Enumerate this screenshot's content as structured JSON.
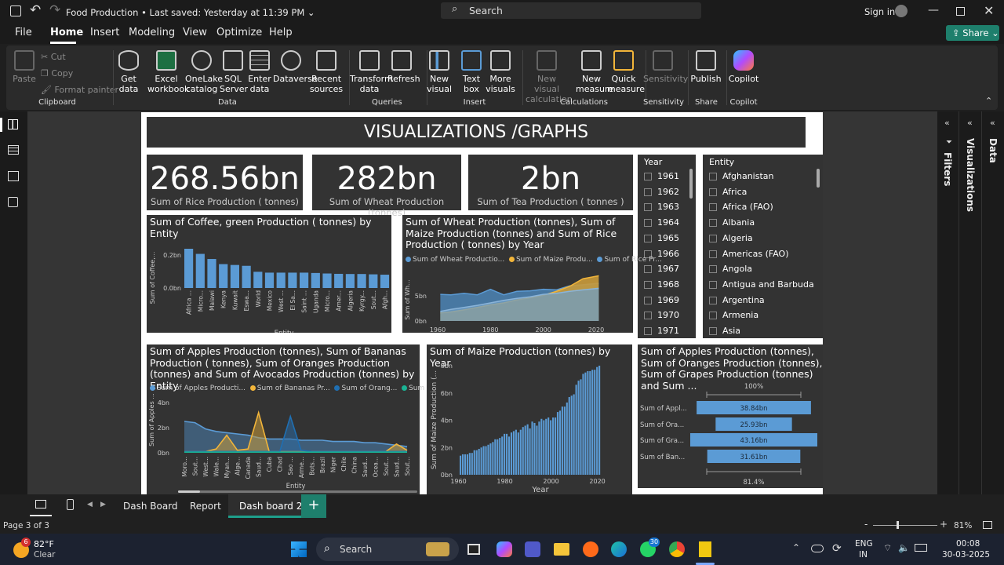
{
  "titlebar": {
    "file_name": "Food Production",
    "separator": " • ",
    "saved": "Last saved: Yesterday at 11:39 PM",
    "search": "Search",
    "signin": "Sign in"
  },
  "menu": [
    "File",
    "Home",
    "Insert",
    "Modeling",
    "View",
    "Optimize",
    "Help"
  ],
  "share": "Share",
  "ribbon": {
    "clipboard": {
      "paste": "Paste",
      "cut": "Cut",
      "copy": "Copy",
      "format_painter": "Format painter",
      "group": "Clipboard"
    },
    "data": {
      "get_data": "Get data",
      "excel": "Excel workbook",
      "onelake": "OneLake catalog",
      "sql": "SQL Server",
      "enter": "Enter data",
      "dataverse": "Dataverse",
      "recent": "Recent sources",
      "group": "Data"
    },
    "queries": {
      "transform": "Transform data",
      "refresh": "Refresh",
      "group": "Queries"
    },
    "insert": {
      "new_visual": "New visual",
      "text_box": "Text box",
      "more_visuals": "More visuals",
      "group": "Insert"
    },
    "calculations": {
      "new_visual_calc": "New visual calculation",
      "new_measure": "New measure",
      "quick_measure": "Quick measure",
      "group": "Calculations"
    },
    "sensitivity": {
      "label": "Sensitivity",
      "group": "Sensitivity"
    },
    "share": {
      "publish": "Publish",
      "group": "Share"
    },
    "copilot": {
      "label": "Copilot",
      "group": "Copilot"
    }
  },
  "report": {
    "header": "VISUALIZATIONS /GRAPHS",
    "kpis": [
      {
        "value": "268.56bn",
        "label": "Sum of Rice  Production ( tonnes)"
      },
      {
        "value": "282bn",
        "label": "Sum of Wheat Production (tonnes)"
      },
      {
        "value": "2bn",
        "label": "Sum of Tea  Production ( tonnes )"
      }
    ],
    "year_slicer": {
      "title": "Year",
      "items": [
        "1961",
        "1962",
        "1963",
        "1964",
        "1965",
        "1966",
        "1967",
        "1968",
        "1969",
        "1970",
        "1971"
      ]
    },
    "entity_slicer": {
      "title": "Entity",
      "items": [
        "Afghanistan",
        "Africa",
        "Africa (FAO)",
        "Albania",
        "Algeria",
        "Americas (FAO)",
        "Angola",
        "Antigua and Barbuda",
        "Argentina",
        "Armenia",
        "Asia"
      ]
    },
    "coffee": {
      "title": "Sum of Coffee, green Production ( tonnes) by Entity",
      "ylabel": "Sum of Coffee,...",
      "xlabel": "Entity",
      "yticks": [
        "0.2bn",
        "0.0bn"
      ]
    },
    "wmr": {
      "title": "Sum of Wheat Production (tonnes), Sum of Maize Production (tonnes) and Sum of Rice Production ( tonnes) by Year",
      "legend": [
        "Sum of Wheat Productio...",
        "Sum of Maize Produ...",
        "Sum of Rice  Pr..."
      ],
      "ylabel": "Sum of Wh...",
      "xlabel": "Year",
      "yticks": [
        "5bn",
        "0bn"
      ]
    },
    "fruits": {
      "title": "Sum of Apples Production (tonnes), Sum of Bananas Production ( tonnes), Sum of Oranges Production (tonnes) and Sum of Avocados Production (tonnes) by Entity",
      "legend": [
        "Sum of Apples Producti...",
        "Sum of Bananas  Pr...",
        "Sum of Orang...",
        "Sum of Avoc..."
      ],
      "ylabel": "Sum of Apples ...",
      "xlabel": "Entity",
      "yticks": [
        "4bn",
        "2bn",
        "0bn"
      ]
    },
    "maize": {
      "title": "Sum of Maize Production (tonnes) by Year",
      "ylabel": "Sum of Maize Production (...",
      "xlabel": "Year",
      "yticks": [
        "8bn",
        "6bn",
        "4bn",
        "2bn",
        "0bn"
      ]
    },
    "funnel": {
      "title": "Sum of Apples Production (tonnes), Sum of Oranges Production (tonnes), Sum of Grapes Production (tonnes) and Sum ...",
      "top_pct": "100%",
      "bottom_pct": "81.4%"
    }
  },
  "chart_data": [
    {
      "type": "bar",
      "title": "Sum of Coffee, green Production ( tonnes) by Entity",
      "xlabel": "Entity",
      "ylabel": "Sum of Coffee,...",
      "categories": [
        "Africa ...",
        "Micro...",
        "Malawi",
        "Kenya",
        "Kuwait",
        "Eswa...",
        "World",
        "Mexico",
        "West ...",
        "El Sa...",
        "Saint ...",
        "Uganda",
        "Micro...",
        "Amer...",
        "Algeria",
        "Kyrgy...",
        "Sout...",
        "Afgh..."
      ],
      "values": [
        0.23,
        0.2,
        0.17,
        0.14,
        0.135,
        0.13,
        0.095,
        0.09,
        0.09,
        0.09,
        0.09,
        0.088,
        0.085,
        0.083,
        0.082,
        0.082,
        0.08,
        0.078
      ],
      "yticks": [
        "0.2bn",
        "0.0bn"
      ]
    },
    {
      "type": "area",
      "title": "Sum of Wheat Production (tonnes), Sum of Maize Production (tonnes) and Sum of Rice Production ( tonnes) by Year",
      "xlabel": "Year",
      "ylabel": "Sum of Wh...",
      "x": [
        1961,
        1965,
        1970,
        1975,
        1980,
        1985,
        1990,
        1995,
        2000,
        2005,
        2010,
        2015,
        2021
      ],
      "series": [
        {
          "name": "Sum of Wheat Productio...",
          "color": "#5b9bd5",
          "values": [
            5.3,
            5.2,
            5.5,
            5.2,
            6.3,
            5.2,
            5.9,
            6.0,
            6.3,
            6.2,
            7.0,
            7.2,
            7.5
          ]
        },
        {
          "name": "Sum of Maize Produ...",
          "color": "#f2b53a",
          "values": [
            1.6,
            1.8,
            2.2,
            2.7,
            3.2,
            3.6,
            4.2,
            4.6,
            5.1,
            5.9,
            6.9,
            8.4,
            9.0
          ]
        },
        {
          "name": "Sum of Rice  Pr...",
          "color": "#5b9bd5",
          "values": [
            1.9,
            2.3,
            2.7,
            3.1,
            3.6,
            4.1,
            4.5,
            4.8,
            5.3,
            5.5,
            5.9,
            6.2,
            6.5
          ]
        }
      ],
      "xticks": [
        "1960",
        "1980",
        "2000",
        "2020"
      ],
      "yticks": [
        "5bn",
        "0bn"
      ]
    },
    {
      "type": "area",
      "title": "Sum of Apples Production (tonnes), Sum of Bananas Production ( tonnes), Sum of Oranges Production (tonnes) and Sum of Avocados Production (tonnes) by Entity",
      "xlabel": "Entity",
      "ylabel": "Sum of Apples ...",
      "categories": [
        "Moro...",
        "Sout...",
        "West...",
        "Wale...",
        "Myan...",
        "Alge...",
        "Canada",
        "Saud...",
        "Cuba",
        "Chad",
        "Sao ...",
        "Arme...",
        "Bots...",
        "Brazil",
        "Niger",
        "Chile",
        "China",
        "Saud...",
        "Ocea...",
        "Sout...",
        "Saud...",
        "Sout..."
      ],
      "series": [
        {
          "name": "Sum of Apples Producti...",
          "color": "#5b9bd5",
          "values": [
            2.5,
            2.4,
            1.9,
            1.7,
            1.6,
            1.5,
            1.4,
            1.2,
            1.1,
            1.1,
            1.1,
            1.0,
            1.0,
            1.0,
            0.9,
            0.9,
            0.9,
            0.8,
            0.8,
            0.7,
            0.6,
            0.5
          ]
        },
        {
          "name": "Sum of Bananas  Pr...",
          "color": "#f2b53a",
          "values": [
            0.1,
            0.1,
            0.1,
            0.3,
            1.4,
            0.2,
            0.3,
            3.2,
            0.1,
            0.1,
            0.1,
            0.1,
            0.1,
            0.1,
            0.1,
            0.1,
            0.1,
            0.1,
            0.1,
            0.1,
            0.7,
            0.2
          ]
        },
        {
          "name": "Sum of Orang...",
          "color": "#1f6fb2",
          "values": [
            0.1,
            0.1,
            0.1,
            0.1,
            0.1,
            0.1,
            0.1,
            0.1,
            0.1,
            0.1,
            2.9,
            0.2,
            0.1,
            0.1,
            0.1,
            0.1,
            0.1,
            0.1,
            0.1,
            0.1,
            0.1,
            0.1
          ]
        },
        {
          "name": "Sum of Avoc...",
          "color": "#1ab394",
          "values": [
            0.05,
            0.05,
            0.05,
            0.05,
            0.05,
            0.05,
            0.05,
            0.05,
            0.05,
            0.05,
            0.05,
            0.05,
            0.05,
            0.05,
            0.05,
            0.05,
            0.05,
            0.05,
            0.05,
            0.05,
            0.05,
            0.05
          ]
        }
      ],
      "yticks": [
        "4bn",
        "2bn",
        "0bn"
      ]
    },
    {
      "type": "bar",
      "title": "Sum of Maize Production (tonnes) by Year",
      "xlabel": "Year",
      "ylabel": "Sum of Maize Production (...",
      "x_range": [
        1961,
        2021
      ],
      "values": [
        1.4,
        1.5,
        1.5,
        1.5,
        1.6,
        1.6,
        1.8,
        1.8,
        1.9,
        2.0,
        2.1,
        2.1,
        2.2,
        2.3,
        2.4,
        2.6,
        2.6,
        2.7,
        2.8,
        3.0,
        3.0,
        2.8,
        3.1,
        3.2,
        3.3,
        3.1,
        3.3,
        3.5,
        3.6,
        3.7,
        3.4,
        3.9,
        3.8,
        3.6,
        3.9,
        4.1,
        4.0,
        4.1,
        4.2,
        4.0,
        4.2,
        4.2,
        4.6,
        4.7,
        5.0,
        5.0,
        5.3,
        5.7,
        5.8,
        5.9,
        6.6,
        6.9,
        7.0,
        7.4,
        7.5,
        7.6,
        7.6,
        7.7,
        7.7,
        7.9,
        8.0
      ],
      "xticks": [
        "1960",
        "1980",
        "2000",
        "2020"
      ],
      "yticks": [
        "8bn",
        "6bn",
        "4bn",
        "2bn",
        "0bn"
      ]
    },
    {
      "type": "bar",
      "title": "Sum of Apples Production (tonnes), Sum of Oranges Production (tonnes), Sum of Grapes Production (tonnes) and Sum ...",
      "categories": [
        "Sum of Appl...",
        "Sum of Ora...",
        "Sum of Gra...",
        "Sum of Ban..."
      ],
      "values": [
        38.84,
        25.93,
        43.16,
        31.61
      ],
      "labels": [
        "38.84bn",
        "25.93bn",
        "43.16bn",
        "31.61bn"
      ],
      "color": "#5b9bd5"
    }
  ],
  "tabs": {
    "items": [
      "Dash Board",
      "Report",
      "Dash board 2"
    ],
    "active": "Dash board 2",
    "add": "+"
  },
  "right_panes": [
    "Filters",
    "Visualizations",
    "Data"
  ],
  "status": {
    "page": "Page 3 of 3",
    "zoom": "81%",
    "minus": "-",
    "plus": "+"
  },
  "taskbar": {
    "temp": "82°F",
    "weather": "Clear",
    "badge_weather": "6",
    "search": "Search",
    "lang1": "ENG",
    "lang2": "IN",
    "time": "00:08",
    "date": "30-03-2025",
    "whatsapp_badge": "30"
  },
  "colors": {
    "accent": "#118dff",
    "bar": "#5b9bd5",
    "maize": "#f2b53a",
    "share": "#1e7f6c"
  }
}
